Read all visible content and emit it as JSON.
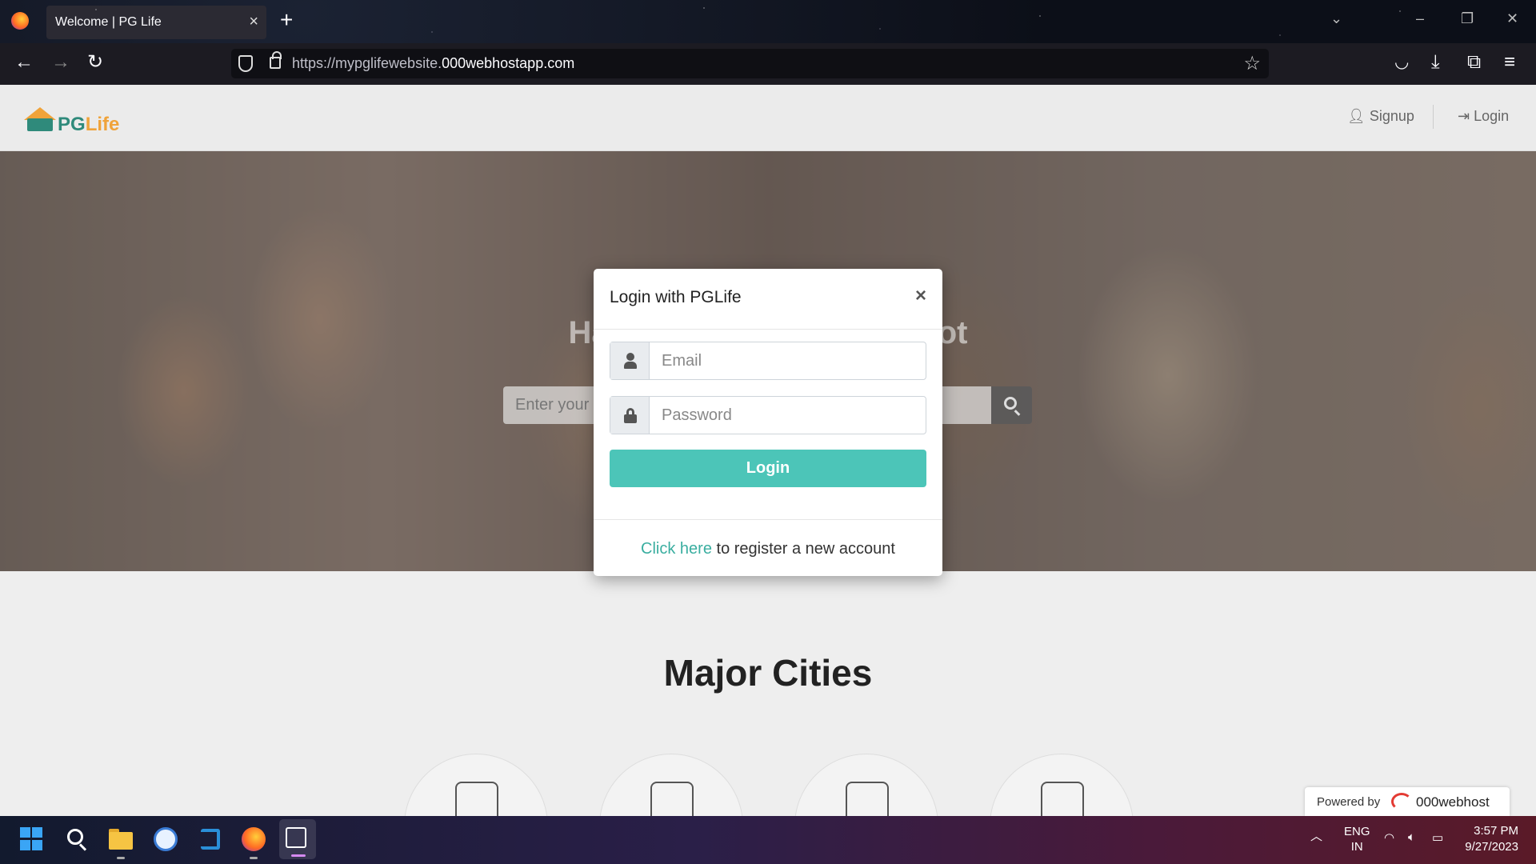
{
  "browser": {
    "tab_title": "Welcome | PG Life",
    "url_prefix": "https://mypglifewebsite.",
    "url_domain": "000webhostapp.com"
  },
  "site": {
    "logo_pg": "PG",
    "logo_life": "Life",
    "nav": {
      "signup": "Signup",
      "login": "Login"
    },
    "hero_title": "Happy Hunting Kiddo! Find your PG spot",
    "hero_visible_left": "Ha",
    "hero_visible_right": "ot",
    "search_placeholder": "Enter your",
    "major_cities_title": "Major Cities",
    "powered_by": "Powered by",
    "powered_brand": "000webhost"
  },
  "modal": {
    "title": "Login with PGLife",
    "close": "×",
    "email_placeholder": "Email",
    "password_placeholder": "Password",
    "login_button": "Login",
    "footer_link": "Click here",
    "footer_text": " to register a new account"
  },
  "taskbar": {
    "lang_1": "ENG",
    "lang_2": "IN",
    "time": "3:57 PM",
    "date": "9/27/2023"
  },
  "colors": {
    "accent": "#4cc5b8",
    "link": "#3aaea0",
    "brand_green": "#2f8a7b",
    "brand_orange": "#f0a33a"
  }
}
